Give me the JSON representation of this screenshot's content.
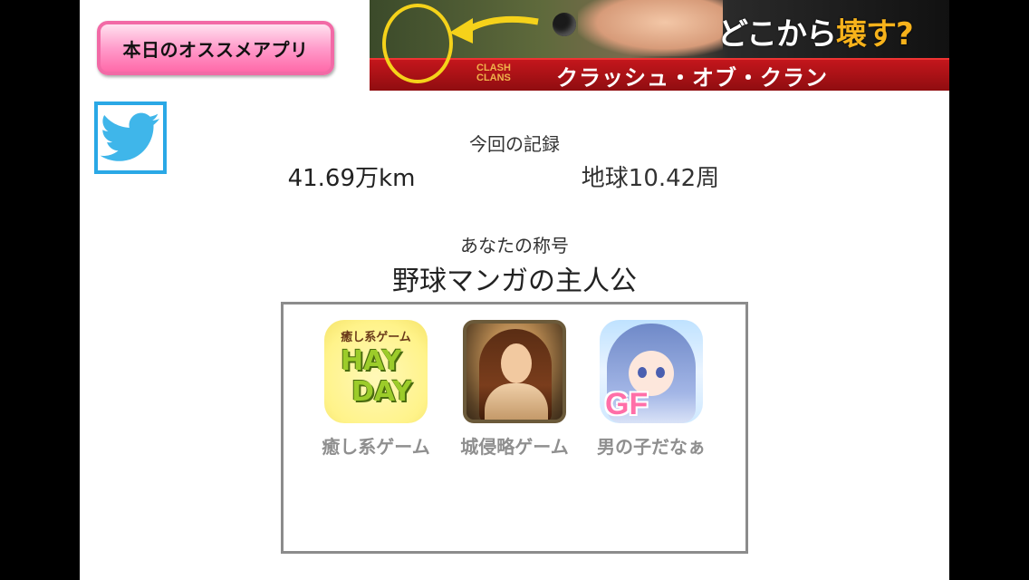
{
  "header": {
    "recommend_button_label": "本日のオススメアプリ",
    "banner": {
      "headline_pre": "どこから",
      "headline_accent": "壊す",
      "headline_post": "?",
      "logo_line1": "CLASH",
      "logo_line2": "CLANS",
      "subtitle": "クラッシュ・オブ・クラン"
    },
    "twitter_icon": "twitter-bird-icon"
  },
  "record": {
    "label": "今回の記録",
    "distance": "41.69万km",
    "earth_laps": "地球10.42周"
  },
  "title": {
    "label": "あなたの称号",
    "value": "野球マンガの主人公"
  },
  "apps": [
    {
      "name": "癒し系ゲーム",
      "icon": "hayday-icon",
      "icon_caption": "癒し系ゲーム",
      "icon_word1": "HAY",
      "icon_word2": "DAY"
    },
    {
      "name": "城侵略ゲーム",
      "icon": "castle-warrior-icon"
    },
    {
      "name": "男の子だなぁ",
      "icon": "anime-girl-icon",
      "icon_logo": "GF"
    }
  ],
  "colors": {
    "reco_border": "#f26aa6",
    "twitter": "#2aa8e6",
    "banner_red": "#c4161c",
    "app_name": "#8f8f8f"
  }
}
